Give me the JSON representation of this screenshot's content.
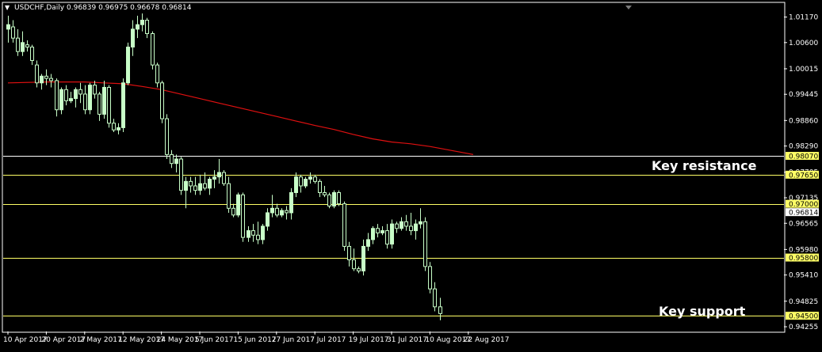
{
  "window": {
    "title": "USDCHF,Daily",
    "ohlc": "0.96839 0.96975 0.96678 0.96814"
  },
  "colors": {
    "background": "#000000",
    "frame": "#ffffff",
    "bull_candle": "#c8ffc8",
    "bear_candle": "#000000",
    "moving_average": "#e01010",
    "level_line_white": "#ffffff",
    "level_line_yellow": "#ffff66",
    "highlight_label_bg": "#ffff66"
  },
  "chart_data": {
    "type": "candlestick",
    "symbol": "USDCHF",
    "timeframe": "Daily",
    "ylim": [
      0.9415,
      1.0148
    ],
    "y_ticks": [
      "1.01170",
      "1.00600",
      "1.00015",
      "0.99445",
      "0.98860",
      "0.98290",
      "0.97705",
      "0.97135",
      "0.96565",
      "0.95980",
      "0.95410",
      "0.94825",
      "0.94255"
    ],
    "x_ticks": [
      {
        "label": "10 Apr 2017",
        "index": 0
      },
      {
        "label": "20 Apr 2017",
        "index": 8
      },
      {
        "label": "2 May 2017",
        "index": 16
      },
      {
        "label": "12 May 2017",
        "index": 24
      },
      {
        "label": "24 May 2017",
        "index": 32
      },
      {
        "label": "5 Jun 2017",
        "index": 40
      },
      {
        "label": "15 Jun 2017",
        "index": 48
      },
      {
        "label": "27 Jun 2017",
        "index": 56
      },
      {
        "label": "7 Jul 2017",
        "index": 64
      },
      {
        "label": "19 Jul 2017",
        "index": 72
      },
      {
        "label": "31 Jul 2017",
        "index": 80
      },
      {
        "label": "10 Aug 2017",
        "index": 88
      },
      {
        "label": "22 Aug 2017",
        "index": 96
      }
    ],
    "levels": [
      {
        "value": 0.9807,
        "label": "0.98070",
        "style": "white"
      },
      {
        "value": 0.9765,
        "label": "0.97650",
        "style": "yellow"
      },
      {
        "value": 0.97,
        "label": "0.97000",
        "style": "yellow"
      },
      {
        "value": 0.958,
        "label": "0.95800",
        "style": "yellow"
      },
      {
        "value": 0.945,
        "label": "0.94500",
        "style": "yellow"
      }
    ],
    "current_price": {
      "value": 0.96814,
      "label": "0.96814"
    },
    "annotations": [
      {
        "text": "Key resistance",
        "near": 0.979
      },
      {
        "text": "Key support",
        "near": 0.9465
      }
    ],
    "moving_average": {
      "color": "red",
      "points": [
        [
          0,
          0.997
        ],
        [
          8,
          0.9972
        ],
        [
          16,
          0.9972
        ],
        [
          20,
          0.997
        ],
        [
          24,
          0.9968
        ],
        [
          28,
          0.9962
        ],
        [
          32,
          0.9955
        ],
        [
          36,
          0.9945
        ],
        [
          40,
          0.9935
        ],
        [
          44,
          0.9925
        ],
        [
          48,
          0.9915
        ],
        [
          52,
          0.9905
        ],
        [
          56,
          0.9895
        ],
        [
          60,
          0.9885
        ],
        [
          64,
          0.9875
        ],
        [
          68,
          0.9866
        ],
        [
          72,
          0.9855
        ],
        [
          76,
          0.9845
        ],
        [
          80,
          0.9838
        ],
        [
          84,
          0.9834
        ],
        [
          88,
          0.9828
        ],
        [
          92,
          0.982
        ],
        [
          96,
          0.9812
        ],
        [
          97,
          0.981
        ]
      ]
    },
    "candles": [
      {
        "o": 1.009,
        "h": 1.012,
        "l": 1.006,
        "c": 1.01
      },
      {
        "o": 1.0095,
        "h": 1.011,
        "l": 1.006,
        "c": 1.007
      },
      {
        "o": 1.007,
        "h": 1.009,
        "l": 1.003,
        "c": 1.004
      },
      {
        "o": 1.004,
        "h": 1.0085,
        "l": 1.003,
        "c": 1.006
      },
      {
        "o": 1.0055,
        "h": 1.0065,
        "l": 1.004,
        "c": 1.005
      },
      {
        "o": 1.005,
        "h": 1.0055,
        "l": 1.001,
        "c": 1.002
      },
      {
        "o": 1.001,
        "h": 1.002,
        "l": 0.996,
        "c": 0.997
      },
      {
        "o": 0.997,
        "h": 0.999,
        "l": 0.9955,
        "c": 0.9985
      },
      {
        "o": 0.9985,
        "h": 1.0,
        "l": 0.9965,
        "c": 0.998
      },
      {
        "o": 0.998,
        "h": 0.999,
        "l": 0.996,
        "c": 0.9975
      },
      {
        "o": 0.9975,
        "h": 0.998,
        "l": 0.9895,
        "c": 0.991
      },
      {
        "o": 0.991,
        "h": 0.996,
        "l": 0.99,
        "c": 0.9955
      },
      {
        "o": 0.9955,
        "h": 0.9965,
        "l": 0.992,
        "c": 0.993
      },
      {
        "o": 0.993,
        "h": 0.995,
        "l": 0.9925,
        "c": 0.9935
      },
      {
        "o": 0.9935,
        "h": 0.996,
        "l": 0.9915,
        "c": 0.9955
      },
      {
        "o": 0.9955,
        "h": 0.997,
        "l": 0.9925,
        "c": 0.9945
      },
      {
        "o": 0.9945,
        "h": 0.9965,
        "l": 0.99,
        "c": 0.991
      },
      {
        "o": 0.991,
        "h": 0.997,
        "l": 0.99,
        "c": 0.9965
      },
      {
        "o": 0.9965,
        "h": 0.9975,
        "l": 0.9935,
        "c": 0.9945
      },
      {
        "o": 0.9945,
        "h": 0.995,
        "l": 0.9885,
        "c": 0.99
      },
      {
        "o": 0.99,
        "h": 0.9975,
        "l": 0.989,
        "c": 0.996
      },
      {
        "o": 0.996,
        "h": 0.9965,
        "l": 0.987,
        "c": 0.988
      },
      {
        "o": 0.988,
        "h": 0.989,
        "l": 0.986,
        "c": 0.9865
      },
      {
        "o": 0.9865,
        "h": 0.988,
        "l": 0.9855,
        "c": 0.987
      },
      {
        "o": 0.987,
        "h": 0.998,
        "l": 0.986,
        "c": 0.997
      },
      {
        "o": 0.997,
        "h": 1.006,
        "l": 0.9965,
        "c": 1.005
      },
      {
        "o": 1.005,
        "h": 1.011,
        "l": 1.003,
        "c": 1.009
      },
      {
        "o": 1.009,
        "h": 1.012,
        "l": 1.007,
        "c": 1.01
      },
      {
        "o": 1.01,
        "h": 1.0125,
        "l": 1.0085,
        "c": 1.011
      },
      {
        "o": 1.011,
        "h": 1.0115,
        "l": 1.007,
        "c": 1.008
      },
      {
        "o": 1.008,
        "h": 1.0085,
        "l": 1.0,
        "c": 1.001
      },
      {
        "o": 1.001,
        "h": 1.0015,
        "l": 0.996,
        "c": 0.997
      },
      {
        "o": 0.997,
        "h": 0.9975,
        "l": 0.988,
        "c": 0.989
      },
      {
        "o": 0.989,
        "h": 0.99,
        "l": 0.98,
        "c": 0.981
      },
      {
        "o": 0.981,
        "h": 0.982,
        "l": 0.978,
        "c": 0.979
      },
      {
        "o": 0.979,
        "h": 0.981,
        "l": 0.977,
        "c": 0.98
      },
      {
        "o": 0.98,
        "h": 0.9805,
        "l": 0.972,
        "c": 0.973
      },
      {
        "o": 0.973,
        "h": 0.976,
        "l": 0.969,
        "c": 0.975
      },
      {
        "o": 0.975,
        "h": 0.976,
        "l": 0.9725,
        "c": 0.974
      },
      {
        "o": 0.974,
        "h": 0.976,
        "l": 0.972,
        "c": 0.973
      },
      {
        "o": 0.973,
        "h": 0.9765,
        "l": 0.972,
        "c": 0.9745
      },
      {
        "o": 0.9745,
        "h": 0.977,
        "l": 0.973,
        "c": 0.9735
      },
      {
        "o": 0.9735,
        "h": 0.976,
        "l": 0.972,
        "c": 0.9755
      },
      {
        "o": 0.9755,
        "h": 0.9775,
        "l": 0.9735,
        "c": 0.976
      },
      {
        "o": 0.976,
        "h": 0.98,
        "l": 0.9745,
        "c": 0.977
      },
      {
        "o": 0.977,
        "h": 0.9775,
        "l": 0.974,
        "c": 0.9745
      },
      {
        "o": 0.9745,
        "h": 0.976,
        "l": 0.968,
        "c": 0.969
      },
      {
        "o": 0.969,
        "h": 0.97,
        "l": 0.967,
        "c": 0.9675
      },
      {
        "o": 0.9675,
        "h": 0.9725,
        "l": 0.967,
        "c": 0.972
      },
      {
        "o": 0.972,
        "h": 0.9725,
        "l": 0.9615,
        "c": 0.9625
      },
      {
        "o": 0.9625,
        "h": 0.965,
        "l": 0.9615,
        "c": 0.964
      },
      {
        "o": 0.964,
        "h": 0.9655,
        "l": 0.9615,
        "c": 0.963
      },
      {
        "o": 0.963,
        "h": 0.966,
        "l": 0.961,
        "c": 0.962
      },
      {
        "o": 0.962,
        "h": 0.9655,
        "l": 0.961,
        "c": 0.965
      },
      {
        "o": 0.965,
        "h": 0.969,
        "l": 0.964,
        "c": 0.968
      },
      {
        "o": 0.968,
        "h": 0.972,
        "l": 0.967,
        "c": 0.969
      },
      {
        "o": 0.969,
        "h": 0.97,
        "l": 0.967,
        "c": 0.9675
      },
      {
        "o": 0.9675,
        "h": 0.969,
        "l": 0.967,
        "c": 0.9685
      },
      {
        "o": 0.9685,
        "h": 0.9695,
        "l": 0.9665,
        "c": 0.968
      },
      {
        "o": 0.968,
        "h": 0.9735,
        "l": 0.9665,
        "c": 0.9725
      },
      {
        "o": 0.9725,
        "h": 0.977,
        "l": 0.9715,
        "c": 0.976
      },
      {
        "o": 0.976,
        "h": 0.9765,
        "l": 0.9725,
        "c": 0.974
      },
      {
        "o": 0.974,
        "h": 0.976,
        "l": 0.9735,
        "c": 0.9755
      },
      {
        "o": 0.9755,
        "h": 0.977,
        "l": 0.9745,
        "c": 0.976
      },
      {
        "o": 0.976,
        "h": 0.9765,
        "l": 0.9745,
        "c": 0.975
      },
      {
        "o": 0.975,
        "h": 0.9755,
        "l": 0.9715,
        "c": 0.9725
      },
      {
        "o": 0.9725,
        "h": 0.974,
        "l": 0.9715,
        "c": 0.972
      },
      {
        "o": 0.972,
        "h": 0.9725,
        "l": 0.969,
        "c": 0.9695
      },
      {
        "o": 0.9695,
        "h": 0.973,
        "l": 0.969,
        "c": 0.9725
      },
      {
        "o": 0.9725,
        "h": 0.973,
        "l": 0.9695,
        "c": 0.97
      },
      {
        "o": 0.97,
        "h": 0.9705,
        "l": 0.9595,
        "c": 0.9605
      },
      {
        "o": 0.9605,
        "h": 0.9615,
        "l": 0.956,
        "c": 0.9575
      },
      {
        "o": 0.9575,
        "h": 0.96,
        "l": 0.955,
        "c": 0.9555
      },
      {
        "o": 0.9555,
        "h": 0.956,
        "l": 0.9545,
        "c": 0.955
      },
      {
        "o": 0.955,
        "h": 0.962,
        "l": 0.954,
        "c": 0.9605
      },
      {
        "o": 0.9605,
        "h": 0.9635,
        "l": 0.9595,
        "c": 0.962
      },
      {
        "o": 0.962,
        "h": 0.965,
        "l": 0.961,
        "c": 0.9645
      },
      {
        "o": 0.9645,
        "h": 0.9655,
        "l": 0.9625,
        "c": 0.9635
      },
      {
        "o": 0.9635,
        "h": 0.965,
        "l": 0.963,
        "c": 0.964
      },
      {
        "o": 0.964,
        "h": 0.9655,
        "l": 0.96,
        "c": 0.961
      },
      {
        "o": 0.961,
        "h": 0.9665,
        "l": 0.96,
        "c": 0.9655
      },
      {
        "o": 0.9655,
        "h": 0.966,
        "l": 0.9635,
        "c": 0.9645
      },
      {
        "o": 0.9645,
        "h": 0.967,
        "l": 0.964,
        "c": 0.966
      },
      {
        "o": 0.966,
        "h": 0.9675,
        "l": 0.964,
        "c": 0.965
      },
      {
        "o": 0.965,
        "h": 0.968,
        "l": 0.963,
        "c": 0.964
      },
      {
        "o": 0.964,
        "h": 0.9665,
        "l": 0.962,
        "c": 0.9655
      },
      {
        "o": 0.9655,
        "h": 0.969,
        "l": 0.9645,
        "c": 0.966
      },
      {
        "o": 0.966,
        "h": 0.967,
        "l": 0.955,
        "c": 0.956
      },
      {
        "o": 0.956,
        "h": 0.957,
        "l": 0.95,
        "c": 0.951
      },
      {
        "o": 0.951,
        "h": 0.9525,
        "l": 0.946,
        "c": 0.947
      },
      {
        "o": 0.947,
        "h": 0.949,
        "l": 0.944,
        "c": 0.9455
      }
    ]
  }
}
